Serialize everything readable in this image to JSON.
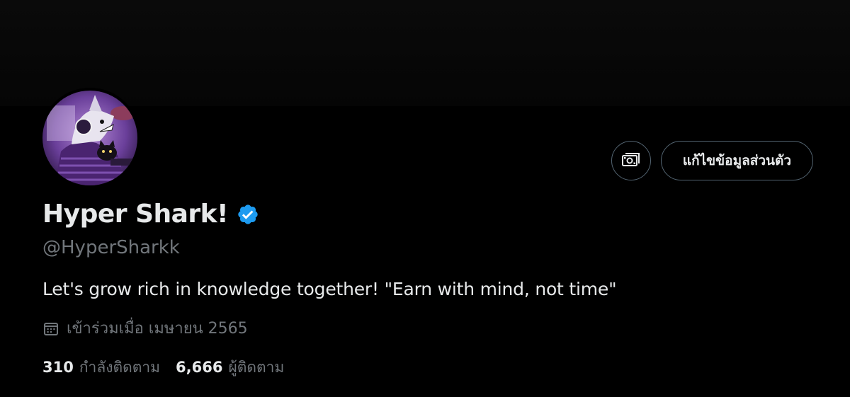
{
  "profile": {
    "display_name": "Hyper Shark!",
    "handle": "@HyperSharkk",
    "bio": "Let's grow rich in knowledge together! \"Earn with mind, not time\"",
    "joined": "เข้าร่วมเมื่อ เมษายน 2565",
    "verified": true
  },
  "actions": {
    "edit_profile_label": "แก้ไขข้อมูลส่วนตัว",
    "monetization_icon": "money-icon"
  },
  "stats": {
    "following_count": "310",
    "following_label": "กำลังติดตาม",
    "followers_count": "6,666",
    "followers_label": "ผู้ติดตาม"
  },
  "colors": {
    "background": "#000000",
    "text_primary": "#e7e9ea",
    "text_secondary": "#71767b",
    "border": "#536471",
    "verified_badge": "#1d9bf0"
  }
}
